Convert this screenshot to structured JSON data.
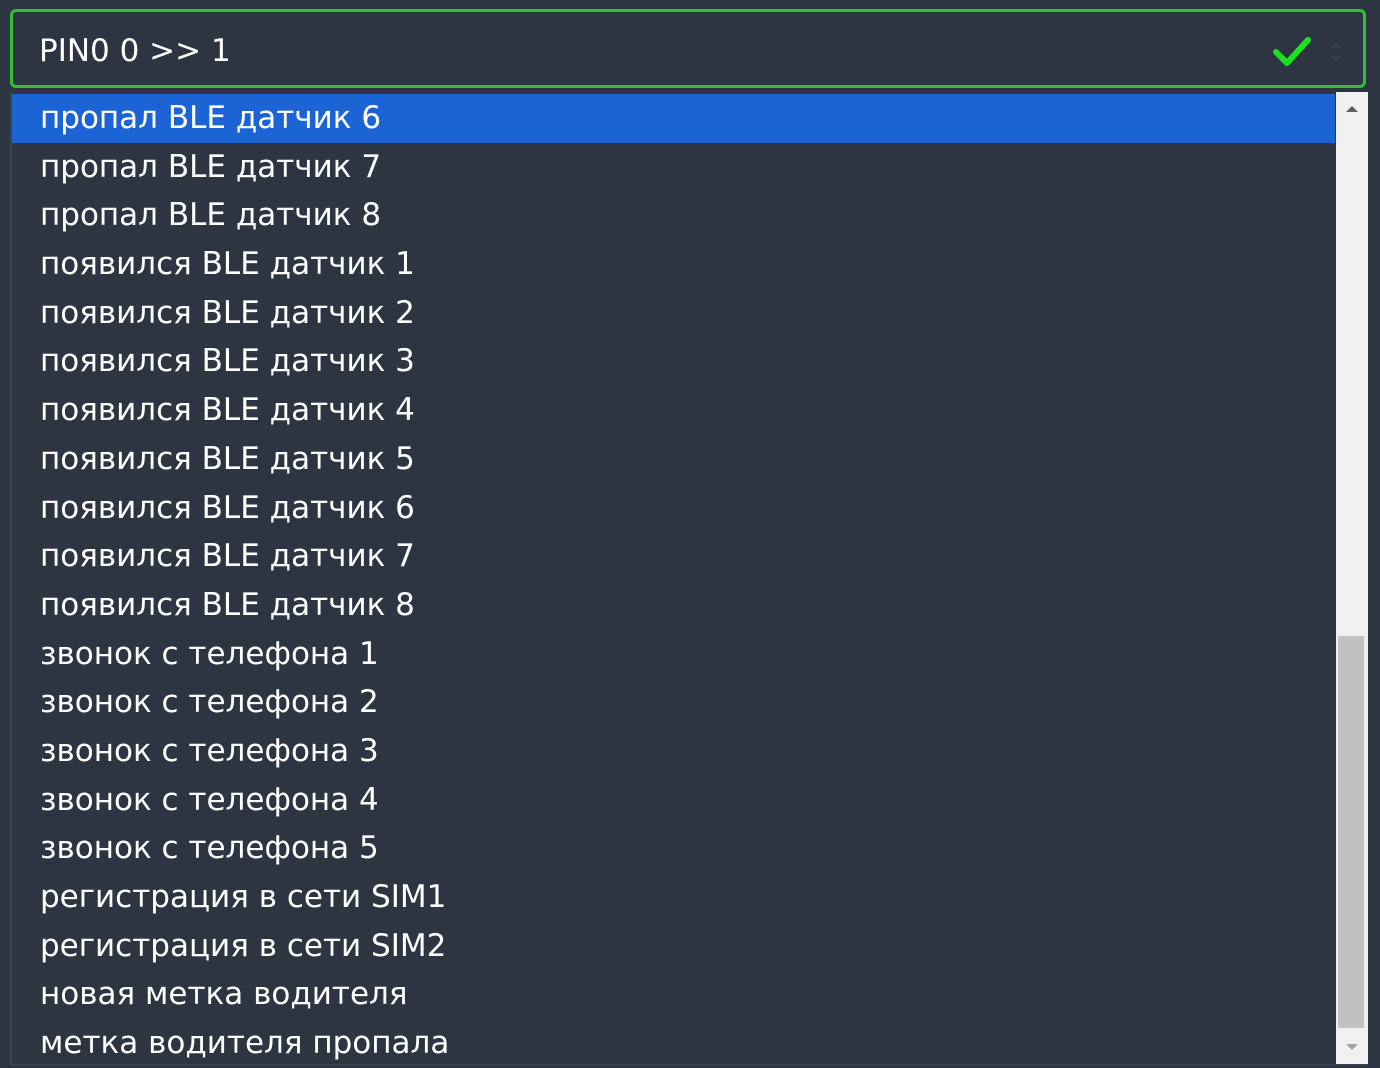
{
  "select": {
    "value": "PIN0 0 >> 1",
    "icon": "checkmark-icon",
    "accent_color": "#2fc12f"
  },
  "dropdown": {
    "selected_index": 0,
    "highlight_color": "#1c64d6",
    "options": [
      "пропал BLE датчик 6",
      "пропал BLE датчик 7",
      "пропал BLE датчик 8",
      "появился BLE датчик 1",
      "появился BLE датчик 2",
      "появился BLE датчик 3",
      "появился BLE датчик 4",
      "появился BLE датчик 5",
      "появился BLE датчик 6",
      "появился BLE датчик 7",
      "появился BLE датчик 8",
      "звонок с телефона 1",
      "звонок с телефона 2",
      "звонок с телефона 3",
      "звонок с телефона 4",
      "звонок с телефона 5",
      "регистрация в сети SIM1",
      "регистрация в сети SIM2",
      "новая метка водителя",
      "метка водителя пропала"
    ]
  }
}
